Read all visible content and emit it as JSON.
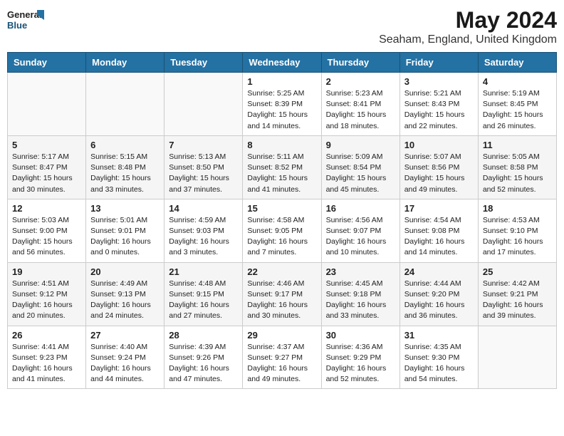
{
  "logo": {
    "general": "General",
    "blue": "Blue"
  },
  "title": "May 2024",
  "subtitle": "Seaham, England, United Kingdom",
  "days_of_week": [
    "Sunday",
    "Monday",
    "Tuesday",
    "Wednesday",
    "Thursday",
    "Friday",
    "Saturday"
  ],
  "weeks": [
    [
      {
        "day": "",
        "info": ""
      },
      {
        "day": "",
        "info": ""
      },
      {
        "day": "",
        "info": ""
      },
      {
        "day": "1",
        "info": "Sunrise: 5:25 AM\nSunset: 8:39 PM\nDaylight: 15 hours\nand 14 minutes."
      },
      {
        "day": "2",
        "info": "Sunrise: 5:23 AM\nSunset: 8:41 PM\nDaylight: 15 hours\nand 18 minutes."
      },
      {
        "day": "3",
        "info": "Sunrise: 5:21 AM\nSunset: 8:43 PM\nDaylight: 15 hours\nand 22 minutes."
      },
      {
        "day": "4",
        "info": "Sunrise: 5:19 AM\nSunset: 8:45 PM\nDaylight: 15 hours\nand 26 minutes."
      }
    ],
    [
      {
        "day": "5",
        "info": "Sunrise: 5:17 AM\nSunset: 8:47 PM\nDaylight: 15 hours\nand 30 minutes."
      },
      {
        "day": "6",
        "info": "Sunrise: 5:15 AM\nSunset: 8:48 PM\nDaylight: 15 hours\nand 33 minutes."
      },
      {
        "day": "7",
        "info": "Sunrise: 5:13 AM\nSunset: 8:50 PM\nDaylight: 15 hours\nand 37 minutes."
      },
      {
        "day": "8",
        "info": "Sunrise: 5:11 AM\nSunset: 8:52 PM\nDaylight: 15 hours\nand 41 minutes."
      },
      {
        "day": "9",
        "info": "Sunrise: 5:09 AM\nSunset: 8:54 PM\nDaylight: 15 hours\nand 45 minutes."
      },
      {
        "day": "10",
        "info": "Sunrise: 5:07 AM\nSunset: 8:56 PM\nDaylight: 15 hours\nand 49 minutes."
      },
      {
        "day": "11",
        "info": "Sunrise: 5:05 AM\nSunset: 8:58 PM\nDaylight: 15 hours\nand 52 minutes."
      }
    ],
    [
      {
        "day": "12",
        "info": "Sunrise: 5:03 AM\nSunset: 9:00 PM\nDaylight: 15 hours\nand 56 minutes."
      },
      {
        "day": "13",
        "info": "Sunrise: 5:01 AM\nSunset: 9:01 PM\nDaylight: 16 hours\nand 0 minutes."
      },
      {
        "day": "14",
        "info": "Sunrise: 4:59 AM\nSunset: 9:03 PM\nDaylight: 16 hours\nand 3 minutes."
      },
      {
        "day": "15",
        "info": "Sunrise: 4:58 AM\nSunset: 9:05 PM\nDaylight: 16 hours\nand 7 minutes."
      },
      {
        "day": "16",
        "info": "Sunrise: 4:56 AM\nSunset: 9:07 PM\nDaylight: 16 hours\nand 10 minutes."
      },
      {
        "day": "17",
        "info": "Sunrise: 4:54 AM\nSunset: 9:08 PM\nDaylight: 16 hours\nand 14 minutes."
      },
      {
        "day": "18",
        "info": "Sunrise: 4:53 AM\nSunset: 9:10 PM\nDaylight: 16 hours\nand 17 minutes."
      }
    ],
    [
      {
        "day": "19",
        "info": "Sunrise: 4:51 AM\nSunset: 9:12 PM\nDaylight: 16 hours\nand 20 minutes."
      },
      {
        "day": "20",
        "info": "Sunrise: 4:49 AM\nSunset: 9:13 PM\nDaylight: 16 hours\nand 24 minutes."
      },
      {
        "day": "21",
        "info": "Sunrise: 4:48 AM\nSunset: 9:15 PM\nDaylight: 16 hours\nand 27 minutes."
      },
      {
        "day": "22",
        "info": "Sunrise: 4:46 AM\nSunset: 9:17 PM\nDaylight: 16 hours\nand 30 minutes."
      },
      {
        "day": "23",
        "info": "Sunrise: 4:45 AM\nSunset: 9:18 PM\nDaylight: 16 hours\nand 33 minutes."
      },
      {
        "day": "24",
        "info": "Sunrise: 4:44 AM\nSunset: 9:20 PM\nDaylight: 16 hours\nand 36 minutes."
      },
      {
        "day": "25",
        "info": "Sunrise: 4:42 AM\nSunset: 9:21 PM\nDaylight: 16 hours\nand 39 minutes."
      }
    ],
    [
      {
        "day": "26",
        "info": "Sunrise: 4:41 AM\nSunset: 9:23 PM\nDaylight: 16 hours\nand 41 minutes."
      },
      {
        "day": "27",
        "info": "Sunrise: 4:40 AM\nSunset: 9:24 PM\nDaylight: 16 hours\nand 44 minutes."
      },
      {
        "day": "28",
        "info": "Sunrise: 4:39 AM\nSunset: 9:26 PM\nDaylight: 16 hours\nand 47 minutes."
      },
      {
        "day": "29",
        "info": "Sunrise: 4:37 AM\nSunset: 9:27 PM\nDaylight: 16 hours\nand 49 minutes."
      },
      {
        "day": "30",
        "info": "Sunrise: 4:36 AM\nSunset: 9:29 PM\nDaylight: 16 hours\nand 52 minutes."
      },
      {
        "day": "31",
        "info": "Sunrise: 4:35 AM\nSunset: 9:30 PM\nDaylight: 16 hours\nand 54 minutes."
      },
      {
        "day": "",
        "info": ""
      }
    ]
  ]
}
